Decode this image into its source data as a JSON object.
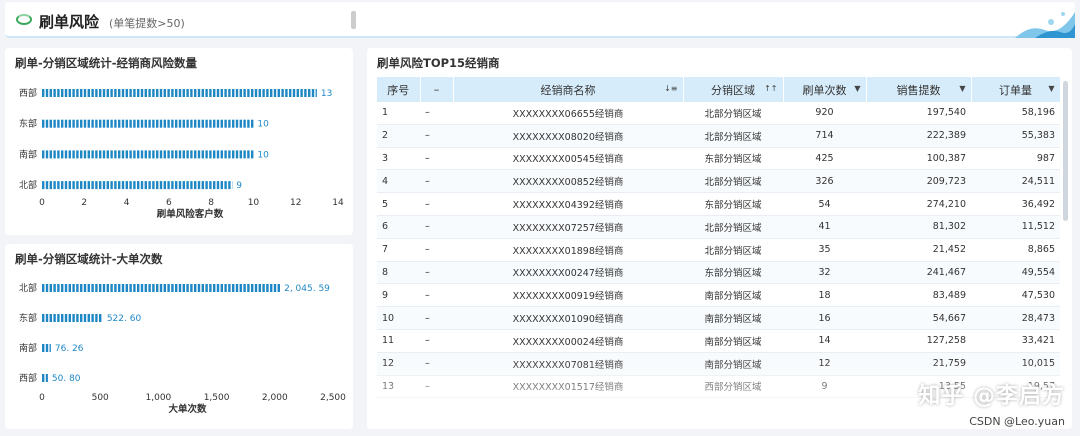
{
  "header": {
    "title": "刷单风险",
    "subtitle": "(单笔提数>50)"
  },
  "left_top": {
    "title": "刷单-分销区域统计-经销商风险数量"
  },
  "left_bottom": {
    "title": "刷单-分销区域统计-大单次数"
  },
  "right": {
    "title": "刷单风险TOP15经销商",
    "columns": [
      "序号",
      "–",
      "经销商名称",
      "分销区域",
      "刷单次数",
      "销售提数",
      "订单量"
    ],
    "rows": [
      [
        "1",
        "–",
        "XXXXXXXX06655经销商",
        "北部分销区域",
        "920",
        "197,540",
        "58,196"
      ],
      [
        "2",
        "–",
        "XXXXXXXX08020经销商",
        "北部分销区域",
        "714",
        "222,389",
        "55,383"
      ],
      [
        "3",
        "–",
        "XXXXXXXX00545经销商",
        "东部分销区域",
        "425",
        "100,387",
        "987"
      ],
      [
        "4",
        "–",
        "XXXXXXXX00852经销商",
        "北部分销区域",
        "326",
        "209,723",
        "24,511"
      ],
      [
        "5",
        "–",
        "XXXXXXXX04392经销商",
        "东部分销区域",
        "54",
        "274,210",
        "36,492"
      ],
      [
        "6",
        "–",
        "XXXXXXXX07257经销商",
        "北部分销区域",
        "41",
        "81,302",
        "11,512"
      ],
      [
        "7",
        "–",
        "XXXXXXXX01898经销商",
        "北部分销区域",
        "35",
        "21,452",
        "8,865"
      ],
      [
        "8",
        "–",
        "XXXXXXXX00247经销商",
        "东部分销区域",
        "32",
        "241,467",
        "49,554"
      ],
      [
        "9",
        "–",
        "XXXXXXXX00919经销商",
        "南部分销区域",
        "18",
        "83,489",
        "47,530"
      ],
      [
        "10",
        "–",
        "XXXXXXXX01090经销商",
        "南部分销区域",
        "16",
        "54,667",
        "28,473"
      ],
      [
        "11",
        "–",
        "XXXXXXXX00024经销商",
        "南部分销区域",
        "14",
        "127,258",
        "33,421"
      ],
      [
        "12",
        "–",
        "XXXXXXXX07081经销商",
        "南部分销区域",
        "12",
        "21,759",
        "10,015"
      ],
      [
        "13",
        "–",
        "XXXXXXXX01517经销商",
        "西部分销区域",
        "9",
        "13,55",
        "19,57"
      ]
    ]
  },
  "watermark": {
    "text": "知乎 @李启方",
    "csdn": "CSDN @Leo.yuan"
  },
  "chart_data": [
    {
      "type": "bar",
      "orientation": "horizontal",
      "title": "刷单-分销区域统计-经销商风险数量",
      "categories": [
        "西部",
        "东部",
        "南部",
        "北部"
      ],
      "values": [
        13,
        10,
        10,
        9
      ],
      "value_labels": [
        "13",
        "10",
        "10",
        "9"
      ],
      "xlabel": "刷单风险客户数",
      "xlim": [
        0,
        14
      ],
      "xticks": [
        0,
        2,
        4,
        6,
        8,
        10,
        12,
        14
      ],
      "color": "#1f87c4"
    },
    {
      "type": "bar",
      "orientation": "horizontal",
      "title": "刷单-分销区域统计-大单次数",
      "categories": [
        "北部",
        "东部",
        "南部",
        "西部"
      ],
      "values": [
        2045.59,
        522.6,
        76.26,
        50.8
      ],
      "value_labels": [
        "2, 045. 59",
        "522. 60",
        "76. 26",
        "50. 80"
      ],
      "xlabel": "大单次数",
      "xlim": [
        0,
        2500
      ],
      "xticks": [
        0,
        500,
        1000,
        1500,
        2000,
        2500
      ],
      "xtick_labels": [
        "0",
        "500",
        "1,000",
        "1,500",
        "2,000",
        "2,500"
      ],
      "color": "#1f87c4"
    }
  ]
}
